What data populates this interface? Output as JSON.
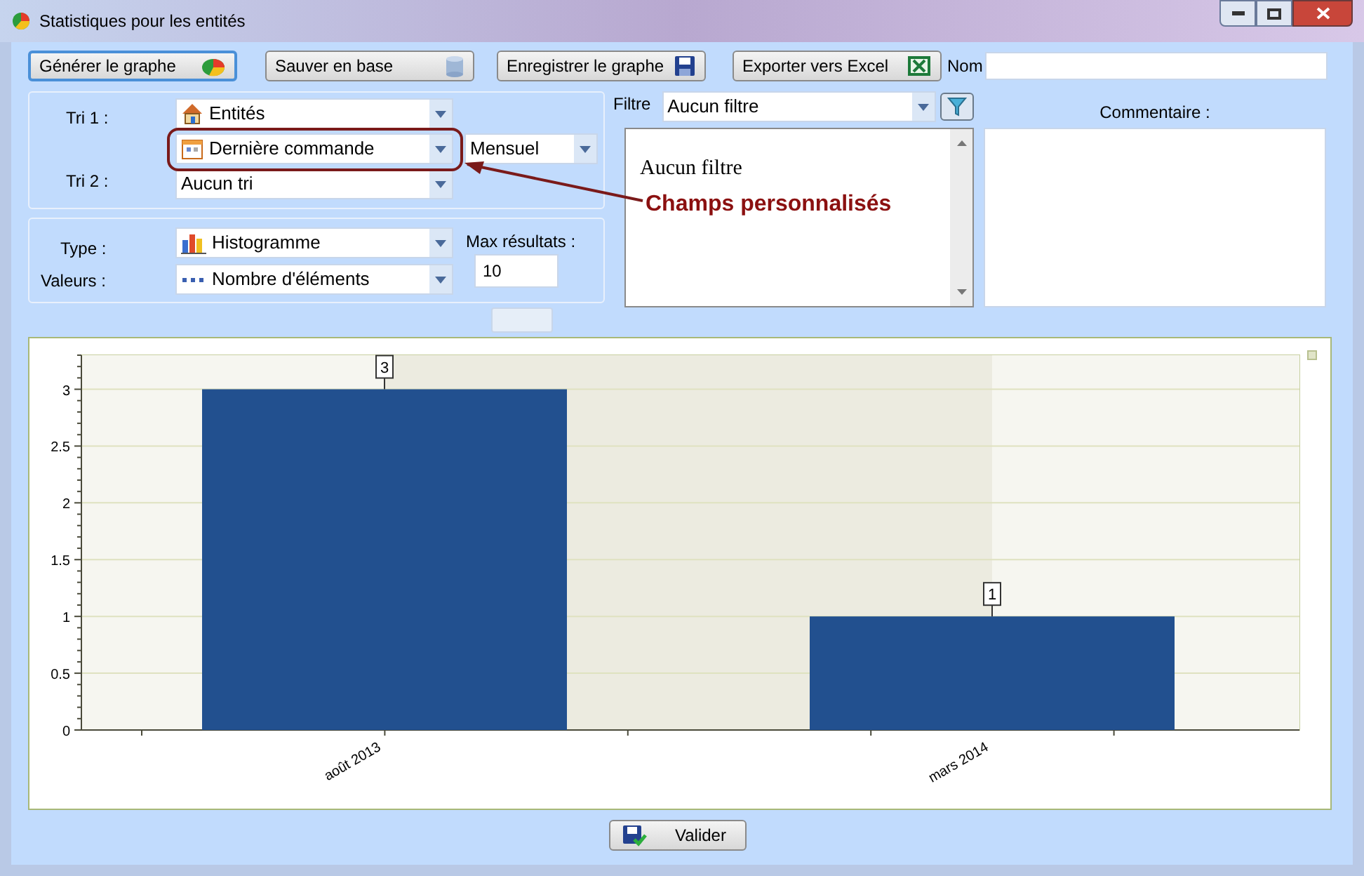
{
  "window": {
    "title": "Statistiques pour les entités"
  },
  "toolbar": {
    "buttons": [
      {
        "label": "Générer le graphe",
        "kind": "pie",
        "selected": true
      },
      {
        "label": "Sauver en base",
        "kind": "database",
        "selected": false
      },
      {
        "label": "Enregistrer le graphe",
        "kind": "floppy",
        "selected": false
      },
      {
        "label": "Exporter vers Excel",
        "kind": "excel",
        "selected": false
      }
    ],
    "name_label": "Nom"
  },
  "sorting": {
    "tri1_label": "Tri 1 :",
    "tri1_value": "Entités",
    "date_field": "Dernière commande",
    "period": "Mensuel",
    "tri2_label": "Tri 2 :",
    "tri2_value": "Aucun tri"
  },
  "display": {
    "type_label": "Type :",
    "type_value": "Histogramme",
    "values_label": "Valeurs :",
    "values_value": "Nombre d'éléments",
    "max_label": "Max résultats :",
    "max_value": "10"
  },
  "filter": {
    "label": "Filtre",
    "value": "Aucun filtre",
    "text": "Aucun filtre"
  },
  "comment": {
    "label": "Commentaire :"
  },
  "annotation": {
    "text": "Champs personnalisés"
  },
  "chart": {
    "chart_data": {
      "type": "bar",
      "categories": [
        "août 2013",
        "mars 2014"
      ],
      "series": [
        {
          "color": "#22508f",
          "values": [
            3,
            1
          ]
        }
      ],
      "grid": true,
      "ylim": [
        0,
        3.3
      ],
      "yticks": [
        0,
        0.5,
        1,
        1.5,
        2,
        2.5,
        3
      ],
      "data_labels": true
    }
  },
  "footer": {
    "button": "Valider"
  }
}
